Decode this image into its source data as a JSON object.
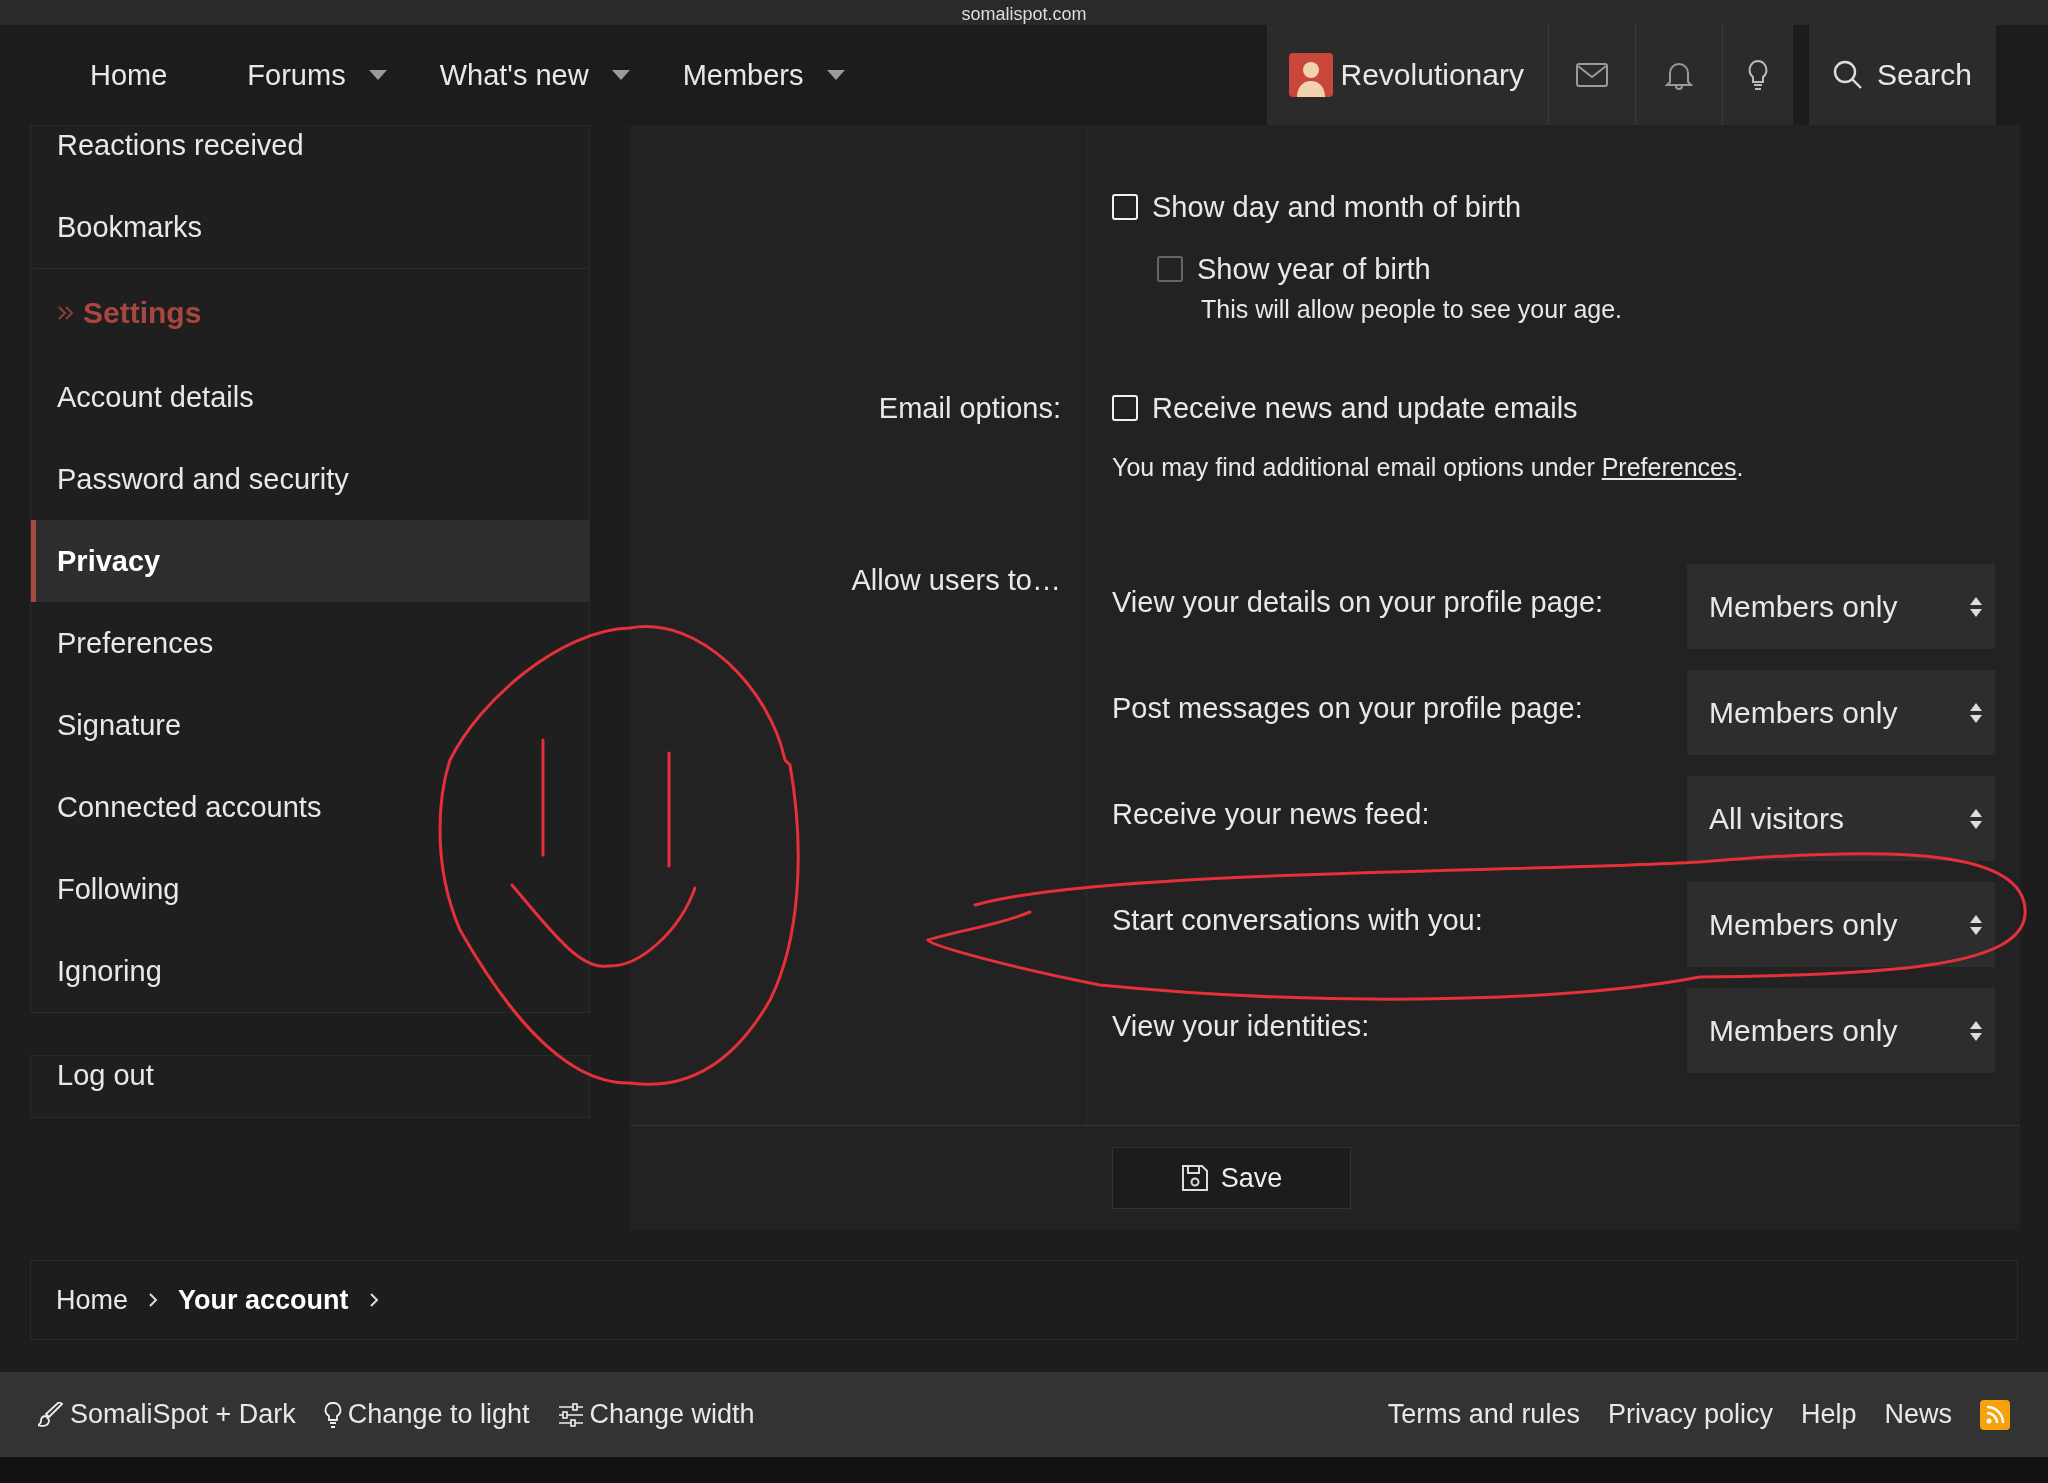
{
  "browser": {
    "address": "somalispot.com"
  },
  "nav": {
    "items": [
      {
        "label": "Home",
        "has_menu": false
      },
      {
        "label": "Forums",
        "has_menu": true
      },
      {
        "label": "What's new",
        "has_menu": true
      },
      {
        "label": "Members",
        "has_menu": true
      }
    ],
    "user": {
      "name": "Revolutionary"
    },
    "search": {
      "label": "Search"
    }
  },
  "sidebar": {
    "items": [
      {
        "label": "Reactions received",
        "selected": false
      },
      {
        "label": "Bookmarks",
        "selected": false
      }
    ],
    "section_title": "Settings",
    "section_items": [
      {
        "label": "Account details",
        "selected": false
      },
      {
        "label": "Password and security",
        "selected": false
      },
      {
        "label": "Privacy",
        "selected": true
      },
      {
        "label": "Preferences",
        "selected": false
      },
      {
        "label": "Signature",
        "selected": false
      },
      {
        "label": "Connected accounts",
        "selected": false
      },
      {
        "label": "Following",
        "selected": false
      },
      {
        "label": "Ignoring",
        "selected": false
      }
    ],
    "logout": "Log out"
  },
  "form": {
    "birth": {
      "checkbox": {
        "label": "Show day and month of birth",
        "checked": false,
        "disabled": false,
        "children": [
          {
            "label": "Show year of birth",
            "checked": false,
            "disabled": true,
            "hint": "This will allow people to see your age."
          }
        ]
      }
    },
    "email": {
      "label": "Email options:",
      "checkbox": {
        "label": "Receive news and update emails",
        "checked": false,
        "disabled": false
      },
      "note_before": "You may find additional email options under ",
      "note_link": "Preferences",
      "note_after": "."
    },
    "allow": {
      "label": "Allow users to…",
      "rows": [
        {
          "label": "View your details on your profile page:",
          "value": "Members only"
        },
        {
          "label": "Post messages on your profile page:",
          "value": "Members only"
        },
        {
          "label": "Receive your news feed:",
          "value": "All visitors"
        },
        {
          "label": "Start conversations with you:",
          "value": "Members only"
        },
        {
          "label": "View your identities:",
          "value": "Members only"
        }
      ]
    },
    "save": "Save"
  },
  "breadcrumb": [
    {
      "label": "Home",
      "current": false
    },
    {
      "label": "Your account",
      "current": true
    }
  ],
  "footer": {
    "left": [
      {
        "label": "SomaliSpot + Dark",
        "kind": "style"
      },
      {
        "label": "Change to light",
        "kind": "theme"
      },
      {
        "label": "Change width",
        "kind": "width"
      }
    ],
    "right": [
      "Terms and rules",
      "Privacy policy",
      "Help",
      "News"
    ]
  }
}
